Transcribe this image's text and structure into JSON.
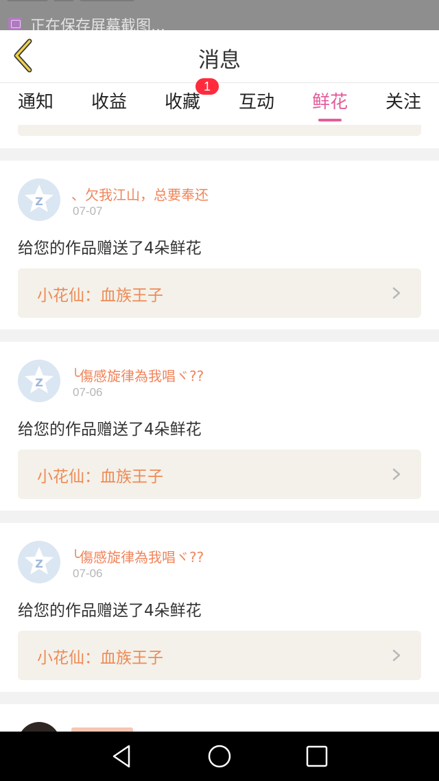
{
  "status_bar": {
    "notification": "正在保存屏幕截图..."
  },
  "header": {
    "title": "消息"
  },
  "tabs": [
    {
      "label": "通知"
    },
    {
      "label": "收益"
    },
    {
      "label": "收藏",
      "badge": "1"
    },
    {
      "label": "互动"
    },
    {
      "label": "鲜花",
      "active": true
    },
    {
      "label": "关注"
    }
  ],
  "messages": [
    {
      "name": "、欠我江山，总要奉还",
      "date": "07-07",
      "text": "给您的作品赠送了4朵鲜花",
      "work": "小花仙：血族王子"
    },
    {
      "name": "╰傷感旋律為我唱ヾ??",
      "date": "07-06",
      "text": "给您的作品赠送了4朵鲜花",
      "work": "小花仙：血族王子"
    },
    {
      "name": "╰傷感旋律為我唱ヾ??",
      "date": "07-06",
      "text": "给您的作品赠送了4朵鲜花",
      "work": "小花仙：血族王子"
    }
  ],
  "colors": {
    "accent": "#e25d9b",
    "name": "#f0845a",
    "work_bg": "#f3f1ea",
    "badge": "#ff2b3d"
  }
}
